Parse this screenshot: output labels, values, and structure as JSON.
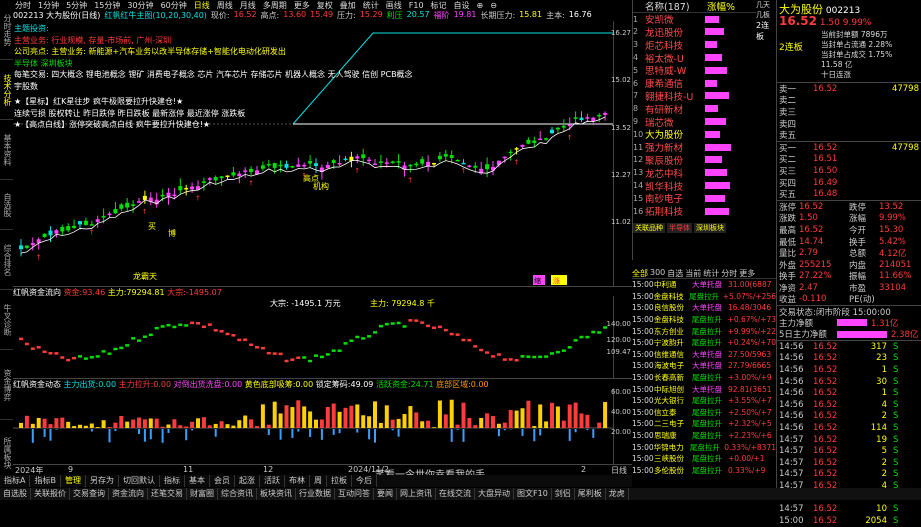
{
  "side_tabs": [
    "分时走势",
    "技术分析",
    "基本资料",
    "自选股",
    "综合排名",
    "牛叉诊断",
    "资金博弈",
    "所属板块"
  ],
  "toolbar": {
    "items": [
      "分时",
      "1分钟",
      "5分钟",
      "15分钟",
      "30分钟",
      "60分钟",
      "日线",
      "周线",
      "月线",
      "多周期",
      "更多",
      "复权",
      "叠加",
      "统计",
      "画线",
      "F10",
      "标记",
      "自设",
      "⊕",
      "⊖"
    ],
    "selected": "日线"
  },
  "header": {
    "code": "002213 大为股份(日线)",
    "indicator": "红帆红牛主图(10,20,30,40)",
    "price_label": "现价:",
    "price": "16.52",
    "high_label": "高点:",
    "high": "13.60",
    "v1": "15.49",
    "press_label": "压力:",
    "press": "15.29",
    "r2": "利压",
    "r2v": "20.57",
    "up_label": "福阶",
    "up": "19.81",
    "lp_label": "长期压力:",
    "lp": "15.81",
    "cost_label": "主本:",
    "cost": "16.76",
    "cost2": "16.66"
  },
  "notes": [
    {
      "t": "主题投资:",
      "c": "cyn"
    },
    {
      "t": "主营业务: 行业规模, 存量-市场前, 广州-深圳",
      "c": "red"
    },
    {
      "t": "公司亮点: 主营业务: 新能源+汽车业务以改半导体存储+智能化电动化研发出",
      "c": "yel"
    },
    {
      "t": "半导体      深圳板块",
      "c": "grn"
    },
    {
      "t": "每笔交易: 四大概念 锂电池概念 锂矿 消费电子概念 芯片 汽车芯片 存储芯片 机器人概念 无人驾驶 信创 PCB概念",
      "c": "wht"
    },
    {
      "t": "宇股数",
      "c": "wht"
    },
    {
      "t": "★【星标】红K星往步 疯牛极限要拉升快建仓!★",
      "c": "wht"
    },
    {
      "t": "连续亏损 股权转让 昨日跌停 昨日跌板 最新涨停 最近涨停 涨跌板",
      "c": "wht"
    },
    {
      "t": "★【高点白线】涨停突破高点白线 疯牛要拉升快建仓!★",
      "c": "wht"
    }
  ],
  "main_scale": [
    "16.27",
    "15.02",
    "13.52",
    "12.27",
    "11.02"
  ],
  "chart_labels": {
    "pull": "挖盘",
    "buy_a": "买",
    "buy_b": "博",
    "cow": "龙霸天",
    "jg": "机构",
    "trade_zone": "拉升",
    "ht": "主导",
    "dt": "高点",
    "x_date": "2024年",
    "x_date2": "2024/11/2",
    "f": "缩",
    "z": "涨"
  },
  "mid_indicator": {
    "name": "红帆资金流向",
    "label1": "资金:",
    "v1": "93.46",
    "label2": "主力:",
    "v2": "79294.81",
    "label3": "大宗:",
    "v3": "-1495.07",
    "chart_note": "大宗:",
    "chart_note_v": "-1495.1 万元",
    "main_note": "主力:",
    "main_note_v": "79294.8 千",
    "scale": [
      "140.00",
      "120.00",
      "109.47"
    ]
  },
  "low_indicator": {
    "name": "红帆资金动态",
    "items": [
      "主力出货:0.00",
      "主力拉升:0.00",
      "对倒出货洗盘:0.00",
      "黄色底部吸筹:0.00",
      "锁定筹码:49.09",
      "活跃资金:24.71",
      "底部区域:0.00"
    ],
    "scale": [
      "60.00",
      "40.00",
      "20.00"
    ]
  },
  "x_axis": [
    "2024年",
    "9",
    "11",
    "12",
    "2024/11/2",
    "2"
  ],
  "x_right": "日线",
  "bottom_tabs": [
    "指标A",
    "指标B",
    "管理",
    "另存为",
    "切回默认",
    "指标",
    "基本",
    "会员",
    "起涨",
    "活跃",
    "布林",
    "周",
    "拉板",
    "今后"
  ],
  "bottom_bar": [
    "自选股",
    "关联报价",
    "交易查询",
    "资金流向",
    "还笔交易",
    "财富圈",
    "综合资讯",
    "板块资讯",
    "行业数据",
    "互动问答",
    "要闻",
    "网上资讯",
    "在线交流",
    "大盘异动",
    "图文F10",
    "剑侣",
    "尾利板",
    "龙虎"
  ],
  "watermark": "笑看一今世你幸看我的手",
  "list_header": {
    "title": "名称(187)",
    "sort": "涨幅%",
    "right": "几天几板"
  },
  "stock_list": [
    {
      "n": "1",
      "name": "安凯微",
      "c": "mag"
    },
    {
      "n": "2",
      "name": "龙迅股份",
      "c": "mag"
    },
    {
      "n": "3",
      "name": "炬芯科技",
      "c": "mag"
    },
    {
      "n": "4",
      "name": "裕太微-U",
      "c": "mag"
    },
    {
      "n": "5",
      "name": "思特威-W",
      "c": "mag"
    },
    {
      "n": "6",
      "name": "康希通信",
      "c": "mag"
    },
    {
      "n": "7",
      "name": "翱捷科技-U",
      "c": "mag"
    },
    {
      "n": "8",
      "name": "有研新材",
      "c": "mag"
    },
    {
      "n": "9",
      "name": "瑞芯微",
      "c": "mag"
    },
    {
      "n": "10",
      "name": "大为股份",
      "c": "yel"
    },
    {
      "n": "11",
      "name": "强力新材",
      "c": "mag"
    },
    {
      "n": "12",
      "name": "聚辰股份",
      "c": "mag"
    },
    {
      "n": "13",
      "name": "龙芯中科",
      "c": "mag"
    },
    {
      "n": "14",
      "name": "凯华科技",
      "c": "mag"
    },
    {
      "n": "15",
      "name": "南砂电子",
      "c": "mag"
    },
    {
      "n": "16",
      "name": "拓荆科技",
      "c": "mag"
    }
  ],
  "list_right": [
    "2连板",
    "",
    "",
    "",
    "",
    "",
    "",
    "",
    "",
    "",
    "",
    "",
    "",
    "",
    "",
    ""
  ],
  "list_tabs": [
    "关联品种",
    "半导体",
    "深圳板块"
  ],
  "ticks_tabs": [
    "全部",
    "300",
    "自选",
    "当前",
    "统计",
    "分时",
    "更多"
  ],
  "ticks": [
    {
      "t": "15:00",
      "n": "中利通",
      "d": "大单托盘",
      "v": "31.00(6887"
    },
    {
      "t": "15:00",
      "n": "金盘科技",
      "d": "尾盘拉升",
      "v": "+5.07%/+256"
    },
    {
      "t": "15:00",
      "n": "良信股份",
      "d": "大单托盘",
      "v": "16.48/3046"
    },
    {
      "t": "15:00",
      "n": "金盘科技",
      "d": "尾盘拉升",
      "v": "+0.67%/+73"
    },
    {
      "t": "15:00",
      "n": "东方创业",
      "d": "尾盘拉升",
      "v": "+9.99%/+22"
    },
    {
      "t": "15:00",
      "n": "宁波韵升",
      "d": "尾盘拉升",
      "v": "+0.24%/+70"
    },
    {
      "t": "15:00",
      "n": "信维通信",
      "d": "大单托盘",
      "v": "27.50/5963"
    },
    {
      "t": "15:00",
      "n": "海波电子",
      "d": "大单托盘",
      "v": "27.79/6665"
    },
    {
      "t": "15:00",
      "n": "长春高新",
      "d": "尾盘拉升",
      "v": "+3.00%/+9"
    },
    {
      "t": "15:00",
      "n": "中际旭创",
      "d": "大单托盘",
      "v": "92.81(3651"
    },
    {
      "t": "15:00",
      "n": "光大银行",
      "d": "尾盘拉升",
      "v": "+3.55%/+7"
    },
    {
      "t": "15:00",
      "n": "信立泰",
      "d": "尾盘拉升",
      "v": "+2.50%/+7"
    },
    {
      "t": "15:00",
      "n": "二三电子",
      "d": "尾盘拉升",
      "v": "+2.32%/+5"
    },
    {
      "t": "15:00",
      "n": "思瑞康",
      "d": "尾盘拉升",
      "v": "+2.23%/+6"
    },
    {
      "t": "15:00",
      "n": "华锦电力",
      "d": "尾盘拉升",
      "v": "0.33%/+8371"
    },
    {
      "t": "15:00",
      "n": "三峡股份",
      "d": "尾盘拉升",
      "v": "+0.00/+1"
    },
    {
      "t": "15:00",
      "n": "多伦股份",
      "d": "尾盘拉升",
      "v": "0.33%/+9"
    }
  ],
  "quote": {
    "name": "大为股份",
    "code": "002213",
    "price": "16.52",
    "chg": "1.50",
    "pct": "9.99%",
    "tag": "2连板",
    "infos": [
      "当前封单额 7896万",
      "当封单占流通 2.28%",
      "当封单占成交 1.75%",
      "11.58 亿",
      "十日连涨"
    ],
    "sell_labels": [
      "卖一",
      "卖二",
      "卖三",
      "卖四",
      "卖五"
    ],
    "sell_prices": [
      "16.52",
      "",
      "",
      "",
      ""
    ],
    "sell_vols": [
      "47798",
      "",
      "",
      "",
      ""
    ],
    "buy_labels": [
      "买一",
      "买二",
      "买三",
      "买四",
      "买五"
    ],
    "buy_prices": [
      "16.52",
      "16.51",
      "16.50",
      "16.49",
      "16.48"
    ],
    "buy_vols": [
      "47798",
      "",
      "",
      "",
      ""
    ],
    "stats": [
      {
        "l": "涨停",
        "v": "16.52",
        "l2": "跌停",
        "v2": "13.52"
      },
      {
        "l": "涨跌",
        "v": "1.50",
        "l2": "涨幅",
        "v2": "9.99%"
      },
      {
        "l": "最高",
        "v": "16.52",
        "l2": "今开",
        "v2": "15.30"
      },
      {
        "l": "最低",
        "v": "14.74",
        "l2": "换手",
        "v2": "5.42%"
      },
      {
        "l": "量比",
        "v": "2.79",
        "l2": "总额",
        "v2": "4.12亿"
      },
      {
        "l": "外盘",
        "v": "255215",
        "l2": "内盘",
        "v2": "214051"
      },
      {
        "l": "换手",
        "v": "27.22%",
        "l2": "振幅",
        "v2": "11.66%"
      },
      {
        "l": "净资",
        "v": "2.47",
        "l2": "市盈",
        "v2": "33104"
      },
      {
        "l": "收益",
        "v": "-0.110",
        "l2": "PE(动)",
        "v2": ""
      }
    ],
    "phase_label": "交易状态:",
    "phase": "闭市阶段 15:00:00",
    "flow1_label": "主力净额",
    "flow1": "1.31亿",
    "flow2_label": "5日主力净额",
    "flow2": "2.38亿",
    "trades": [
      {
        "t": "14:56",
        "p": "16.52",
        "v": "317",
        "s": "S"
      },
      {
        "t": "14:56",
        "p": "16.52",
        "v": "23",
        "s": "S"
      },
      {
        "t": "14:56",
        "p": "16.52",
        "v": "1",
        "s": "S"
      },
      {
        "t": "14:56",
        "p": "16.52",
        "v": "30",
        "s": "S"
      },
      {
        "t": "14:56",
        "p": "16.52",
        "v": "1",
        "s": "S"
      },
      {
        "t": "14:56",
        "p": "16.52",
        "v": "4",
        "s": "S"
      },
      {
        "t": "14:56",
        "p": "16.52",
        "v": "2",
        "s": "S"
      },
      {
        "t": "14:56",
        "p": "16.52",
        "v": "114",
        "s": "S"
      },
      {
        "t": "14:57",
        "p": "16.52",
        "v": "19",
        "s": "S"
      },
      {
        "t": "14:57",
        "p": "16.52",
        "v": "5",
        "s": "S"
      },
      {
        "t": "14:57",
        "p": "16.52",
        "v": "2",
        "s": "S"
      },
      {
        "t": "14:57",
        "p": "16.52",
        "v": "2",
        "s": "S"
      },
      {
        "t": "14:57",
        "p": "16.52",
        "v": "4",
        "s": "S"
      },
      {
        "t": "14:57",
        "p": "16.52",
        "v": "13",
        "s": "S"
      },
      {
        "t": "14:57",
        "p": "16.52",
        "v": "10",
        "s": "S"
      },
      {
        "t": "15:00",
        "p": "16.52",
        "v": "2054",
        "s": "S"
      }
    ]
  }
}
